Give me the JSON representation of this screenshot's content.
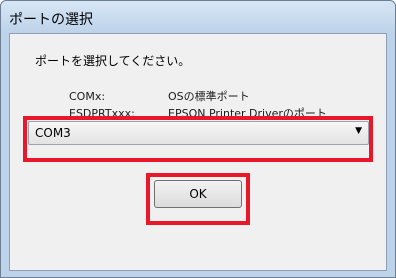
{
  "window": {
    "title": "ポートの選択"
  },
  "dialog": {
    "prompt": "ポートを選択してください。",
    "ports": [
      {
        "name": "COMx:",
        "description": "OSの標準ポート"
      },
      {
        "name": "ESDPRTxxx:",
        "description": "EPSON Printer Driverのポート"
      }
    ],
    "port_select": {
      "value": "COM3"
    },
    "ok_label": "OK"
  },
  "colors": {
    "highlight": "#e8182a"
  }
}
